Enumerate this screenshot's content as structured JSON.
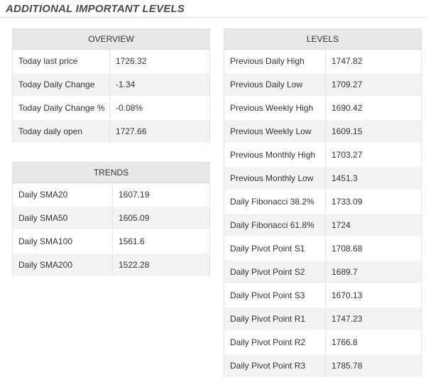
{
  "heading": "ADDITIONAL IMPORTANT LEVELS",
  "overview": {
    "title": "OVERVIEW",
    "rows": [
      {
        "label": "Today last price",
        "value": "1726.32"
      },
      {
        "label": "Today Daily Change",
        "value": "-1.34"
      },
      {
        "label": "Today Daily Change %",
        "value": "-0.08%"
      },
      {
        "label": "Today daily open",
        "value": "1727.66"
      }
    ]
  },
  "trends": {
    "title": "TRENDS",
    "rows": [
      {
        "label": "Daily SMA20",
        "value": "1607.19"
      },
      {
        "label": "Daily SMA50",
        "value": "1605.09"
      },
      {
        "label": "Daily SMA100",
        "value": "1561.6"
      },
      {
        "label": "Daily SMA200",
        "value": "1522.28"
      }
    ]
  },
  "levels": {
    "title": "LEVELS",
    "rows": [
      {
        "label": "Previous Daily High",
        "value": "1747.82"
      },
      {
        "label": "Previous Daily Low",
        "value": "1709.27"
      },
      {
        "label": "Previous Weekly High",
        "value": "1690.42"
      },
      {
        "label": "Previous Weekly Low",
        "value": "1609.15"
      },
      {
        "label": "Previous Monthly High",
        "value": "1703.27"
      },
      {
        "label": "Previous Monthly Low",
        "value": "1451.3"
      },
      {
        "label": "Daily Fibonacci 38.2%",
        "value": "1733.09"
      },
      {
        "label": "Daily Fibonacci 61.8%",
        "value": "1724"
      },
      {
        "label": "Daily Pivot Point S1",
        "value": "1708.68"
      },
      {
        "label": "Daily Pivot Point S2",
        "value": "1689.7"
      },
      {
        "label": "Daily Pivot Point S3",
        "value": "1670.13"
      },
      {
        "label": "Daily Pivot Point R1",
        "value": "1747.23"
      },
      {
        "label": "Daily Pivot Point R2",
        "value": "1766.8"
      },
      {
        "label": "Daily Pivot Point R3",
        "value": "1785.78"
      }
    ]
  }
}
